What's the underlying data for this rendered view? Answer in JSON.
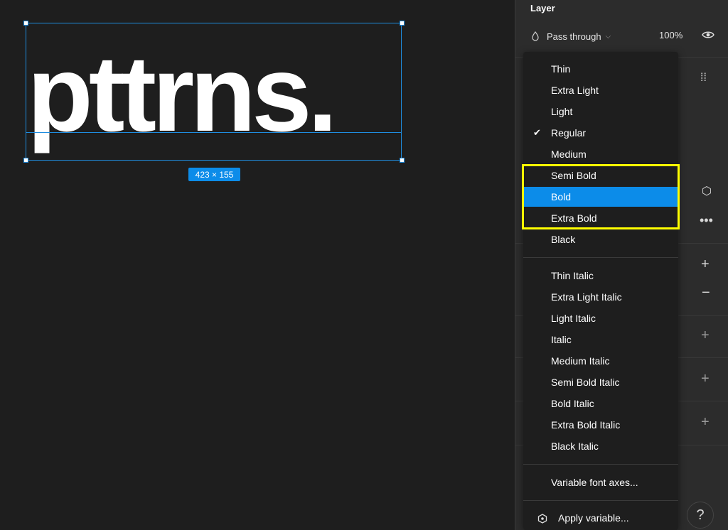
{
  "canvas": {
    "text_content": "pttrns.",
    "size_badge": "423 × 155"
  },
  "layer_panel": {
    "title": "Layer",
    "blend_mode": "Pass through",
    "opacity": "100%"
  },
  "font_weight_menu": {
    "selected_index": 6,
    "checked_index": 3,
    "group1": [
      "Thin",
      "Extra Light",
      "Light",
      "Regular",
      "Medium",
      "Semi Bold",
      "Bold",
      "Extra Bold",
      "Black"
    ],
    "group2": [
      "Thin Italic",
      "Extra Light Italic",
      "Light Italic",
      "Italic",
      "Medium Italic",
      "Semi Bold Italic",
      "Bold Italic",
      "Extra Bold Italic",
      "Black Italic"
    ],
    "variable_axes": "Variable font axes...",
    "apply_variable": "Apply variable..."
  },
  "help": "?",
  "icons": {
    "blend": "drop-icon",
    "visibility": "eye-icon",
    "check": "check-icon",
    "apply": "hexagon-variable-icon"
  },
  "colors": {
    "selection": "#0c8ce9",
    "annotation_highlight": "#ffff00"
  }
}
